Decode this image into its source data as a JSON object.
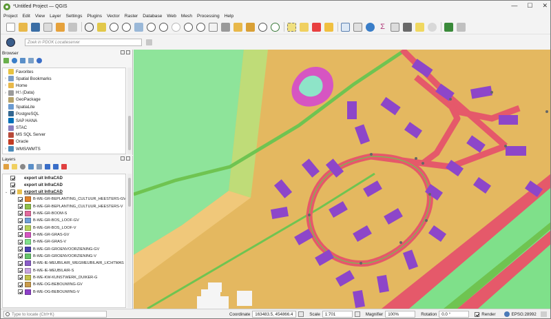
{
  "window": {
    "title": "*Untitled Project — QGIS",
    "controls": [
      "—",
      "☐",
      "✕"
    ]
  },
  "menu": [
    "Project",
    "Edit",
    "View",
    "Layer",
    "Settings",
    "Plugins",
    "Vector",
    "Raster",
    "Database",
    "Web",
    "Mesh",
    "Processing",
    "Help"
  ],
  "locator_bar": {
    "placeholder": "Zoek in PDOK Locatieserver"
  },
  "browser": {
    "title": "Browser",
    "items": [
      {
        "label": "Favorites",
        "icon": "star-icon",
        "color": "#e8c340",
        "expand": false
      },
      {
        "label": "Spatial Bookmarks",
        "icon": "bookmark-icon",
        "color": "#7a9cc6",
        "expand": true
      },
      {
        "label": "Home",
        "icon": "home-folder-icon",
        "color": "#e8b84a",
        "expand": true
      },
      {
        "label": "H:\\ (Data)",
        "icon": "drive-icon",
        "color": "#9a9a9a",
        "expand": true
      },
      {
        "label": "GeoPackage",
        "icon": "geopackage-icon",
        "color": "#b6a36b",
        "expand": false
      },
      {
        "label": "SpatiaLite",
        "icon": "spatialite-icon",
        "color": "#6a9ad0",
        "expand": false
      },
      {
        "label": "PostgreSQL",
        "icon": "postgresql-icon",
        "color": "#336791",
        "expand": false
      },
      {
        "label": "SAP HANA",
        "icon": "sap-hana-icon",
        "color": "#0070b8",
        "expand": false
      },
      {
        "label": "STAC",
        "icon": "stac-icon",
        "color": "#8a7fbf",
        "expand": false
      },
      {
        "label": "MS SQL Server",
        "icon": "mssql-icon",
        "color": "#b84a3a",
        "expand": false
      },
      {
        "label": "Oracle",
        "icon": "oracle-icon",
        "color": "#c23b22",
        "expand": false
      },
      {
        "label": "WMS/WMTS",
        "icon": "wms-icon",
        "color": "#4a8ab8",
        "expand": true
      }
    ]
  },
  "layers": {
    "title": "Layers",
    "groups": [
      {
        "label": "export uit InfraCAD",
        "checked": true
      },
      {
        "label": "export uit InfraCAD",
        "checked": true
      },
      {
        "label": "export uit InfraCAD",
        "checked": true
      }
    ],
    "items": [
      {
        "label": "B-WE-GR-BEPLANTING_CULTUUR_HEESTERS-GV",
        "color": "#e0822a",
        "checked": true
      },
      {
        "label": "B-WE-GR-BEPLANTING_CULTUUR_HEESTERS-V",
        "color": "#8fc04a",
        "checked": true
      },
      {
        "label": "B-WE-GR-BOOM-S",
        "color": "#e36b9e",
        "checked": true
      },
      {
        "label": "B-WE-GR-BOS_LOOF-GV",
        "color": "#6f9fd8",
        "checked": true
      },
      {
        "label": "B-WE-GR-BOS_LOOF-V",
        "color": "#b6d35a",
        "checked": true
      },
      {
        "label": "B-WE-GR-GRAS-GV",
        "color": "#d655c2",
        "checked": true
      },
      {
        "label": "B-WE-GR-GRAS-V",
        "color": "#7fe08a",
        "checked": true
      },
      {
        "label": "B-WE-GR-GROENVOORZIENING-GV",
        "color": "#4a3fb0",
        "checked": true
      },
      {
        "label": "B-WE-GR-GROENVOORZIENING-V",
        "color": "#64c46a",
        "checked": true
      },
      {
        "label": "B-WE-IE-MEUBILAIR_WEGMEUBILAIR_LICHTMAS",
        "color": "#8a5cc8",
        "checked": true
      },
      {
        "label": "B-WE-IE-MEUBILAIR-S",
        "color": "#c9a4e0",
        "checked": true
      },
      {
        "label": "B-WE-KW-KUNSTWERK_DUIKER-G",
        "color": "#c2c24a",
        "checked": true
      },
      {
        "label": "B-WE-OG-BEBOUWING-GV",
        "color": "#c99a4a",
        "checked": true
      },
      {
        "label": "B-WE-OG-BEBOUWING-V",
        "color": "#8e40c8",
        "checked": true
      }
    ]
  },
  "status": {
    "locate_placeholder": "Type to locate (Ctrl+K)",
    "coordinate_label": "Coordinate",
    "coordinate_value": "163483.5, 454866.4",
    "scale_label": "Scale",
    "scale_value": "1:701",
    "magnifier_label": "Magnifier",
    "magnifier_value": "100%",
    "rotation_label": "Rotation",
    "rotation_value": "0.0 °",
    "render_label": "Render",
    "crs_label": "EPSG:28992"
  },
  "map_colors": {
    "base": "#e4b860",
    "grass": "#8ee49a",
    "road": "#e5596a",
    "building": "#8d46c9",
    "verge": "#6fc451",
    "water_pink": "#d655c2"
  }
}
